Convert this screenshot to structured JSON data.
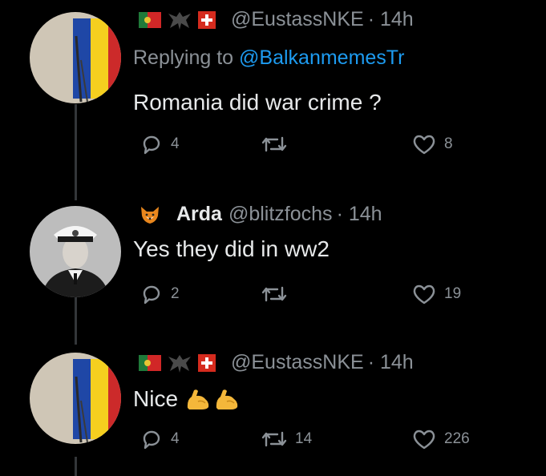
{
  "colors": {
    "background": "#000000",
    "text": "#e7e9ea",
    "muted": "#8b9197",
    "link": "#1d9bf0",
    "thread_line": "#333639"
  },
  "tweets": [
    {
      "header_icons": [
        "portugal-flag-icon",
        "eagle-icon",
        "swiss-flag-icon"
      ],
      "handle": "@EustassNKE",
      "time": "· 14h",
      "replying_prefix": "Replying to",
      "replying_handle": "@BalkanmemesTr",
      "text": "Romania did war crime ?",
      "replies": "4",
      "retweets": "",
      "likes": "8"
    },
    {
      "header_icons": [
        "fox-emoji-icon"
      ],
      "name": "Arda",
      "handle": "@blitzfochs",
      "time": "· 14h",
      "text": "Yes they did in ww2",
      "replies": "2",
      "retweets": "",
      "likes": "19"
    },
    {
      "header_icons": [
        "portugal-flag-icon",
        "eagle-icon",
        "swiss-flag-icon"
      ],
      "handle": "@EustassNKE",
      "time": "· 14h",
      "text": "Nice",
      "text_icons": [
        "flexed-biceps-icon",
        "flexed-biceps-icon"
      ],
      "replies": "4",
      "retweets": "14",
      "likes": "226"
    }
  ]
}
